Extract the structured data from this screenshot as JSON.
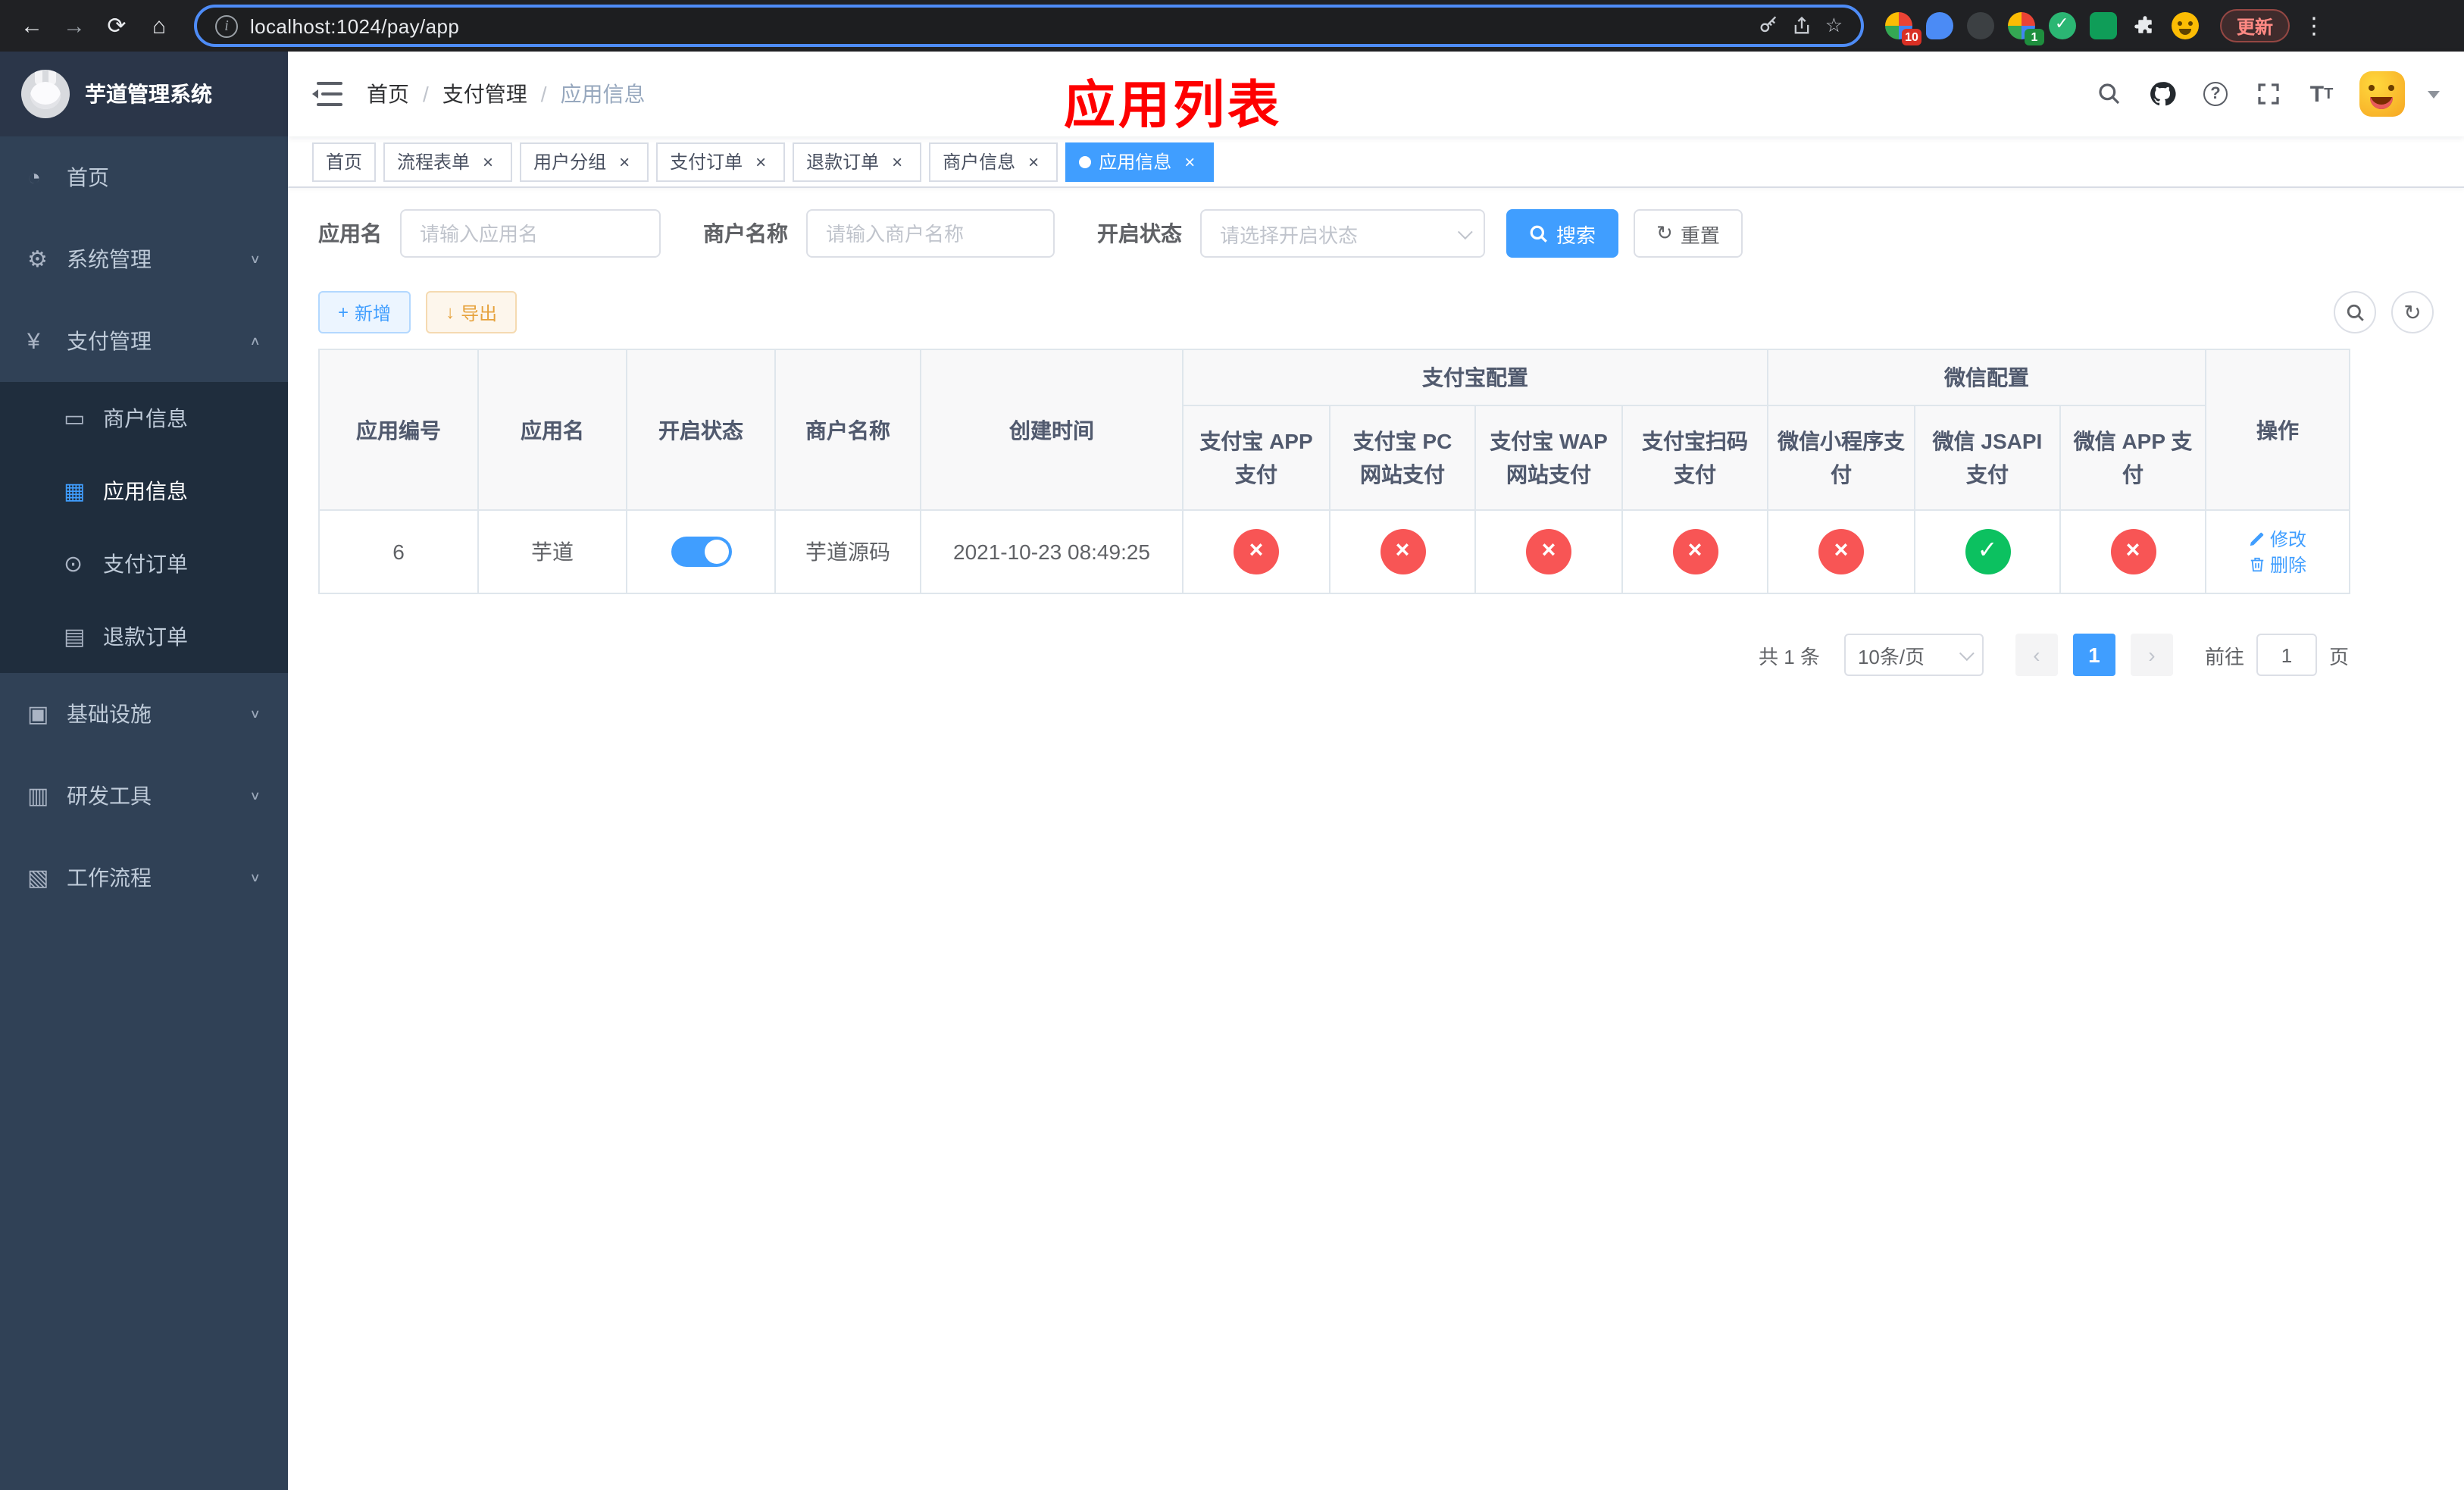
{
  "browser": {
    "url": "localhost:1024/pay/app",
    "update_label": "更新",
    "ext_badge_1": "10",
    "ext_badge_2": "1"
  },
  "sidebar": {
    "title": "芋道管理系统",
    "items": [
      {
        "label": "首页"
      },
      {
        "label": "系统管理"
      },
      {
        "label": "支付管理",
        "children": [
          {
            "label": "商户信息"
          },
          {
            "label": "应用信息",
            "active": true
          },
          {
            "label": "支付订单"
          },
          {
            "label": "退款订单"
          }
        ]
      },
      {
        "label": "基础设施"
      },
      {
        "label": "研发工具"
      },
      {
        "label": "工作流程"
      }
    ]
  },
  "header": {
    "breadcrumb": [
      "首页",
      "支付管理",
      "应用信息"
    ],
    "annotation": "应用列表"
  },
  "tabs": [
    {
      "label": "首页",
      "closable": false,
      "active": false
    },
    {
      "label": "流程表单",
      "closable": true,
      "active": false
    },
    {
      "label": "用户分组",
      "closable": true,
      "active": false
    },
    {
      "label": "支付订单",
      "closable": true,
      "active": false
    },
    {
      "label": "退款订单",
      "closable": true,
      "active": false
    },
    {
      "label": "商户信息",
      "closable": true,
      "active": false
    },
    {
      "label": "应用信息",
      "closable": true,
      "active": true
    }
  ],
  "filters": {
    "app_name_label": "应用名",
    "app_name_placeholder": "请输入应用名",
    "merchant_label": "商户名称",
    "merchant_placeholder": "请输入商户名称",
    "status_label": "开启状态",
    "status_placeholder": "请选择开启状态",
    "search_label": "搜索",
    "reset_label": "重置"
  },
  "toolbar": {
    "add_label": "新增",
    "export_label": "导出"
  },
  "table": {
    "fixed_columns": [
      "应用编号",
      "应用名",
      "开启状态",
      "商户名称",
      "创建时间"
    ],
    "alipay_group": "支付宝配置",
    "wechat_group": "微信配置",
    "alipay_columns": [
      "支付宝 APP 支付",
      "支付宝 PC 网站支付",
      "支付宝 WAP 网站支付",
      "支付宝扫码支付"
    ],
    "wechat_columns": [
      "微信小程序支付",
      "微信 JSAPI 支付",
      "微信 APP 支付"
    ],
    "ops_column": "操作",
    "rows": [
      {
        "id": "6",
        "name": "芋道",
        "enabled": true,
        "merchant": "芋道源码",
        "created_at": "2021-10-23 08:49:25",
        "configs": [
          "no",
          "no",
          "no",
          "no",
          "no",
          "yes",
          "no"
        ],
        "edit_label": "修改",
        "delete_label": "删除"
      }
    ]
  },
  "pagination": {
    "total_text": "共 1 条",
    "page_size_text": "10条/页",
    "current_page": "1",
    "goto_prefix": "前往",
    "goto_value": "1",
    "goto_suffix": "页"
  },
  "colors": {
    "primary": "#409eff",
    "danger": "#f85555",
    "success": "#0cc160",
    "annotation_red": "#fe0000",
    "sidebar_bg": "#304156",
    "submenu_bg": "#1f2d3d"
  }
}
